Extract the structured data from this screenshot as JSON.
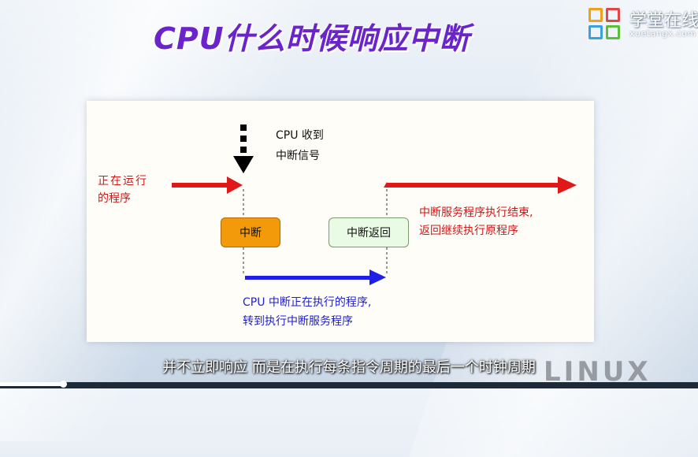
{
  "slide": {
    "title": "CPU什么时候响应中断",
    "logo_text": "学堂在线",
    "logo_sub": "xuetangx.com"
  },
  "diagram": {
    "signal_label_line1": "CPU 收到",
    "signal_label_line2": "中断信号",
    "running_label_line1": "正在运行",
    "running_label_line2": "的程序",
    "interrupt_box": "中断",
    "return_box": "中断返回",
    "isr_label_line1": "CPU 中断正在执行的程序,",
    "isr_label_line2": "转到执行中断服务程序",
    "resume_label_line1": "中断服务程序执行结束,",
    "resume_label_line2": "返回继续执行原程序",
    "colors": {
      "red_arrow": "#e01818",
      "blue_arrow": "#1f1fe6",
      "interrupt_box_fill": "#f29a0a",
      "return_box_fill": "#e9fbe4"
    }
  },
  "caption": {
    "subtitle": "并不立即响应 而是在执行每条指令周期的最后一个时钟周期",
    "watermark": "LINUX"
  },
  "player": {
    "progress_fraction": 0.09
  }
}
